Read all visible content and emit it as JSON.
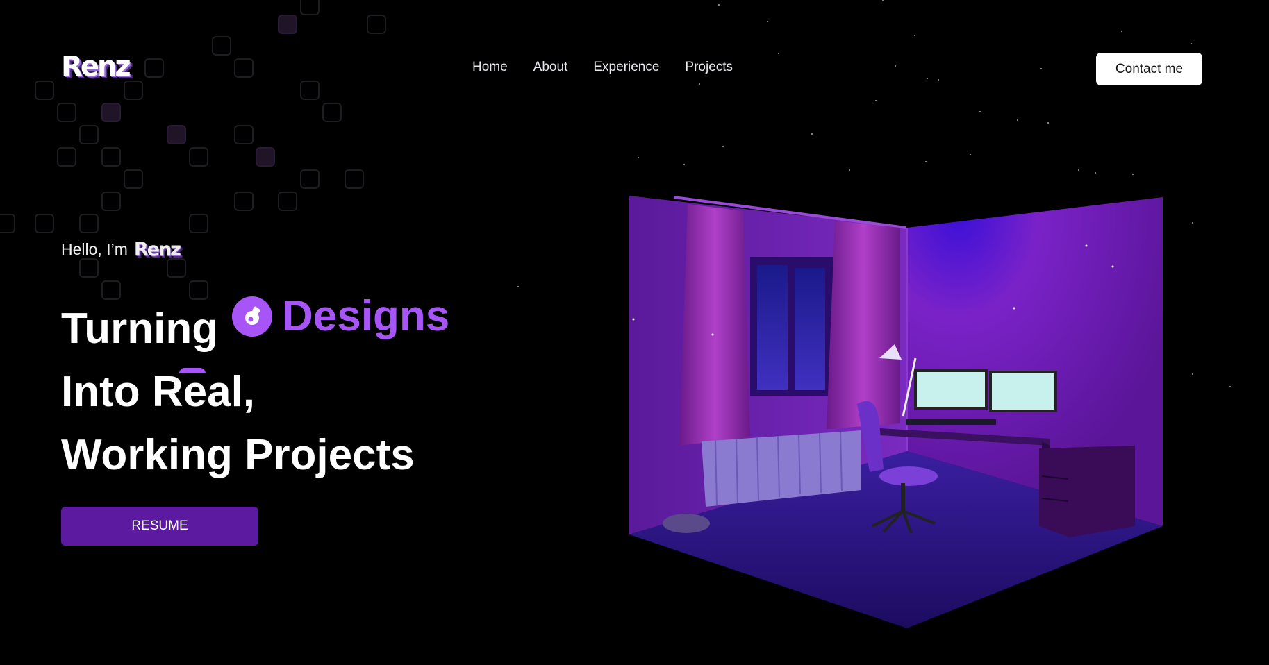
{
  "header": {
    "logo_text": "Renz",
    "nav": [
      {
        "label": "Home"
      },
      {
        "label": "About"
      },
      {
        "label": "Experience"
      },
      {
        "label": "Projects"
      }
    ],
    "contact_label": "Contact me"
  },
  "hero": {
    "greeting": "Hello, I’m",
    "greeting_logo": "Renz",
    "line1": "Turning",
    "highlight_word": "Designs",
    "line2": "Into Real,",
    "line3": "Working Projects",
    "resume_label": "RESUME"
  },
  "colors": {
    "background": "#000000",
    "accent": "#a855f7",
    "button": "#5b1aa0"
  },
  "icons": {
    "designs": "pen-tool-icon"
  }
}
